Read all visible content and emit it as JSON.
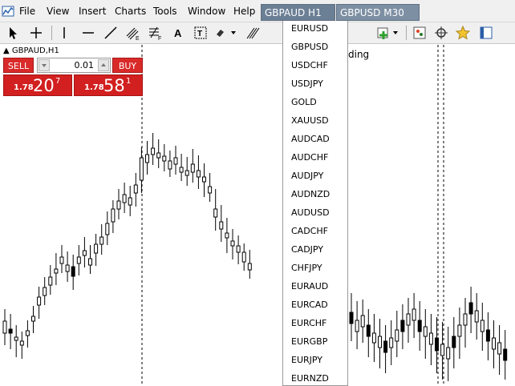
{
  "menu": {
    "items": [
      "File",
      "View",
      "Insert",
      "Charts",
      "Tools",
      "Window",
      "Help"
    ]
  },
  "tabs": [
    {
      "label": "GBPAUD H1",
      "active": true
    },
    {
      "label": "GBPUSD M30",
      "active": false
    }
  ],
  "toolbar": {
    "trading_label": "ding"
  },
  "chart": {
    "label": "GBPAUD,H1",
    "candle_color": "#000000",
    "bull_fill": "#ffffff",
    "bear_fill": "#000000"
  },
  "one_click": {
    "sell_label": "SELL",
    "buy_label": "BUY",
    "lots": "0.01",
    "sell_prefix": "1.78",
    "sell_main": "20",
    "sell_sup": "7",
    "buy_prefix": "1.78",
    "buy_main": "58",
    "buy_sup": "1",
    "color": "#d21f1f"
  },
  "symbol_dropdown": {
    "items": [
      "EURUSD",
      "GBPUSD",
      "USDCHF",
      "USDJPY",
      "GOLD",
      "XAUUSD",
      "AUDCAD",
      "AUDCHF",
      "AUDJPY",
      "AUDNZD",
      "AUDUSD",
      "CADCHF",
      "CADJPY",
      "CHFJPY",
      "EURAUD",
      "EURCAD",
      "EURCHF",
      "EURGBP",
      "EURJPY",
      "EURNZD"
    ]
  }
}
